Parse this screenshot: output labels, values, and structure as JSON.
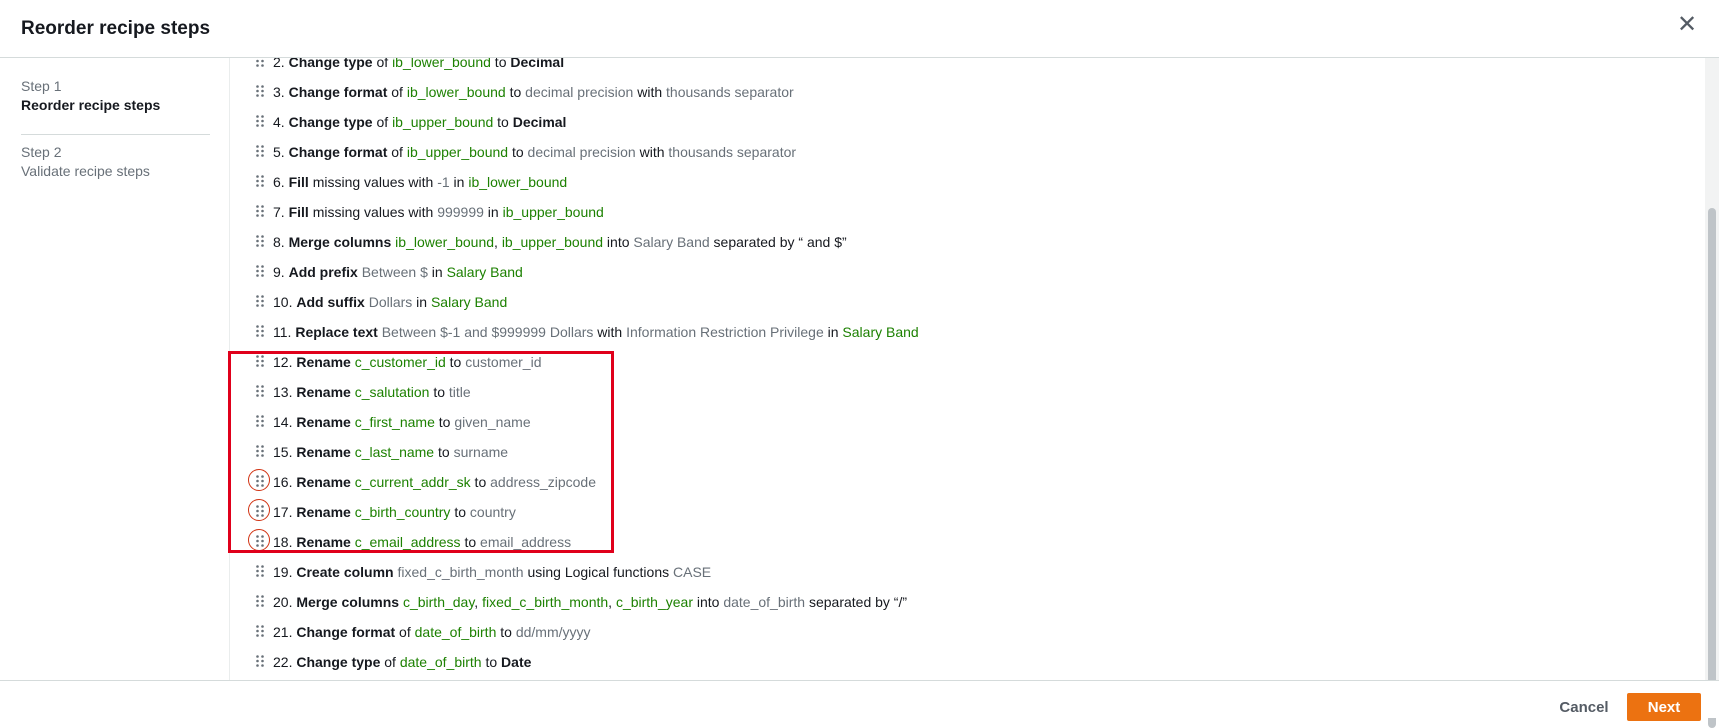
{
  "modal": {
    "title": "Reorder recipe steps",
    "close_icon": "close-icon"
  },
  "wizard": {
    "steps": [
      {
        "number": "Step 1",
        "name": "Reorder recipe steps",
        "active": true
      },
      {
        "number": "Step 2",
        "name": "Validate recipe steps",
        "active": false
      }
    ]
  },
  "recipe_steps": [
    {
      "num": "2.",
      "parts": [
        [
          "kw",
          "Change type"
        ],
        [
          "plain",
          " of "
        ],
        [
          "col",
          "ib_lower_bound"
        ],
        [
          "plain",
          " to "
        ],
        [
          "kw",
          "Decimal"
        ]
      ]
    },
    {
      "num": "3.",
      "parts": [
        [
          "kw",
          "Change format"
        ],
        [
          "plain",
          " of "
        ],
        [
          "col",
          "ib_lower_bound"
        ],
        [
          "plain",
          " to "
        ],
        [
          "val",
          "decimal precision"
        ],
        [
          "plain",
          " with "
        ],
        [
          "val",
          "thousands separator"
        ]
      ]
    },
    {
      "num": "4.",
      "parts": [
        [
          "kw",
          "Change type"
        ],
        [
          "plain",
          " of "
        ],
        [
          "col",
          "ib_upper_bound"
        ],
        [
          "plain",
          " to "
        ],
        [
          "kw",
          "Decimal"
        ]
      ]
    },
    {
      "num": "5.",
      "parts": [
        [
          "kw",
          "Change format"
        ],
        [
          "plain",
          " of "
        ],
        [
          "col",
          "ib_upper_bound"
        ],
        [
          "plain",
          " to "
        ],
        [
          "val",
          "decimal precision"
        ],
        [
          "plain",
          " with "
        ],
        [
          "val",
          "thousands separator"
        ]
      ]
    },
    {
      "num": "6.",
      "parts": [
        [
          "kw",
          "Fill"
        ],
        [
          "plain",
          " missing values with "
        ],
        [
          "val",
          "-1"
        ],
        [
          "plain",
          " in "
        ],
        [
          "col",
          "ib_lower_bound"
        ]
      ]
    },
    {
      "num": "7.",
      "parts": [
        [
          "kw",
          "Fill"
        ],
        [
          "plain",
          " missing values with "
        ],
        [
          "val",
          "999999"
        ],
        [
          "plain",
          " in "
        ],
        [
          "col",
          "ib_upper_bound"
        ]
      ]
    },
    {
      "num": "8.",
      "parts": [
        [
          "kw",
          "Merge columns"
        ],
        [
          "plain",
          " "
        ],
        [
          "col",
          "ib_lower_bound"
        ],
        [
          "plain",
          ", "
        ],
        [
          "col",
          "ib_upper_bound"
        ],
        [
          "plain",
          " into "
        ],
        [
          "val",
          "Salary Band"
        ],
        [
          "plain",
          " separated by “ and $”"
        ]
      ]
    },
    {
      "num": "9.",
      "parts": [
        [
          "kw",
          "Add prefix"
        ],
        [
          "plain",
          " "
        ],
        [
          "val",
          "Between $"
        ],
        [
          "plain",
          " in "
        ],
        [
          "col",
          "Salary Band"
        ]
      ]
    },
    {
      "num": "10.",
      "parts": [
        [
          "kw",
          "Add suffix"
        ],
        [
          "plain",
          "  "
        ],
        [
          "val",
          "Dollars"
        ],
        [
          "plain",
          " in "
        ],
        [
          "col",
          "Salary Band"
        ]
      ]
    },
    {
      "num": "11.",
      "parts": [
        [
          "kw",
          "Replace text"
        ],
        [
          "plain",
          " "
        ],
        [
          "val",
          "Between $-1 and $999999 Dollars"
        ],
        [
          "plain",
          " with "
        ],
        [
          "val",
          "Information Restriction Privilege"
        ],
        [
          "plain",
          " in "
        ],
        [
          "col",
          "Salary Band"
        ]
      ]
    },
    {
      "num": "12.",
      "parts": [
        [
          "kw",
          "Rename"
        ],
        [
          "plain",
          " "
        ],
        [
          "col",
          "c_customer_id"
        ],
        [
          "plain",
          " to "
        ],
        [
          "val",
          "customer_id"
        ]
      ]
    },
    {
      "num": "13.",
      "parts": [
        [
          "kw",
          "Rename"
        ],
        [
          "plain",
          " "
        ],
        [
          "col",
          "c_salutation"
        ],
        [
          "plain",
          " to "
        ],
        [
          "val",
          "title"
        ]
      ]
    },
    {
      "num": "14.",
      "parts": [
        [
          "kw",
          "Rename"
        ],
        [
          "plain",
          " "
        ],
        [
          "col",
          "c_first_name"
        ],
        [
          "plain",
          " to "
        ],
        [
          "val",
          "given_name"
        ]
      ]
    },
    {
      "num": "15.",
      "parts": [
        [
          "kw",
          "Rename"
        ],
        [
          "plain",
          " "
        ],
        [
          "col",
          "c_last_name"
        ],
        [
          "plain",
          " to "
        ],
        [
          "val",
          "surname"
        ]
      ]
    },
    {
      "num": "16.",
      "circled": true,
      "parts": [
        [
          "kw",
          "Rename"
        ],
        [
          "plain",
          " "
        ],
        [
          "col",
          "c_current_addr_sk"
        ],
        [
          "plain",
          " to "
        ],
        [
          "val",
          "address_zipcode"
        ]
      ]
    },
    {
      "num": "17.",
      "circled": true,
      "parts": [
        [
          "kw",
          "Rename"
        ],
        [
          "plain",
          " "
        ],
        [
          "col",
          "c_birth_country"
        ],
        [
          "plain",
          " to "
        ],
        [
          "val",
          "country"
        ]
      ]
    },
    {
      "num": "18.",
      "circled": true,
      "parts": [
        [
          "kw",
          "Rename"
        ],
        [
          "plain",
          " "
        ],
        [
          "col",
          "c_email_address"
        ],
        [
          "plain",
          " to "
        ],
        [
          "val",
          "email_address"
        ]
      ]
    },
    {
      "num": "19.",
      "parts": [
        [
          "kw",
          "Create column"
        ],
        [
          "plain",
          " "
        ],
        [
          "val",
          "fixed_c_birth_month"
        ],
        [
          "plain",
          " using Logical functions "
        ],
        [
          "val",
          "CASE"
        ]
      ]
    },
    {
      "num": "20.",
      "parts": [
        [
          "kw",
          "Merge columns"
        ],
        [
          "plain",
          " "
        ],
        [
          "col",
          "c_birth_day"
        ],
        [
          "plain",
          ", "
        ],
        [
          "col",
          "fixed_c_birth_month"
        ],
        [
          "plain",
          ", "
        ],
        [
          "col",
          "c_birth_year"
        ],
        [
          "plain",
          " into "
        ],
        [
          "val",
          "date_of_birth"
        ],
        [
          "plain",
          " separated by “/”"
        ]
      ]
    },
    {
      "num": "21.",
      "parts": [
        [
          "kw",
          "Change format"
        ],
        [
          "plain",
          " of "
        ],
        [
          "col",
          "date_of_birth"
        ],
        [
          "plain",
          " to "
        ],
        [
          "val",
          "dd/mm/yyyy"
        ]
      ]
    },
    {
      "num": "22.",
      "parts": [
        [
          "kw",
          "Change type"
        ],
        [
          "plain",
          " of "
        ],
        [
          "col",
          "date_of_birth"
        ],
        [
          "plain",
          " to "
        ],
        [
          "kw",
          "Date"
        ]
      ]
    }
  ],
  "footer": {
    "cancel_label": "Cancel",
    "next_label": "Next"
  },
  "colors": {
    "accent": "#ec7211",
    "column_green": "#1d8102",
    "highlight_red": "#e0001b"
  }
}
